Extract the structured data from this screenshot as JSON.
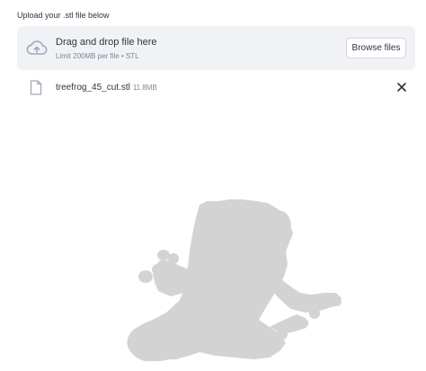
{
  "uploader": {
    "label": "Upload your .stl file below",
    "dropzone_title": "Drag and drop file here",
    "dropzone_limit": "Limit 200MB per file • STL",
    "browse_label": "Browse files",
    "cloud_icon": "cloud-upload-icon"
  },
  "file": {
    "name": "treefrog_45_cut.stl",
    "size": "11.8MB",
    "file_icon": "file-icon",
    "remove_icon": "close-icon"
  },
  "viewer": {
    "model_color": "#d3d3d3"
  }
}
